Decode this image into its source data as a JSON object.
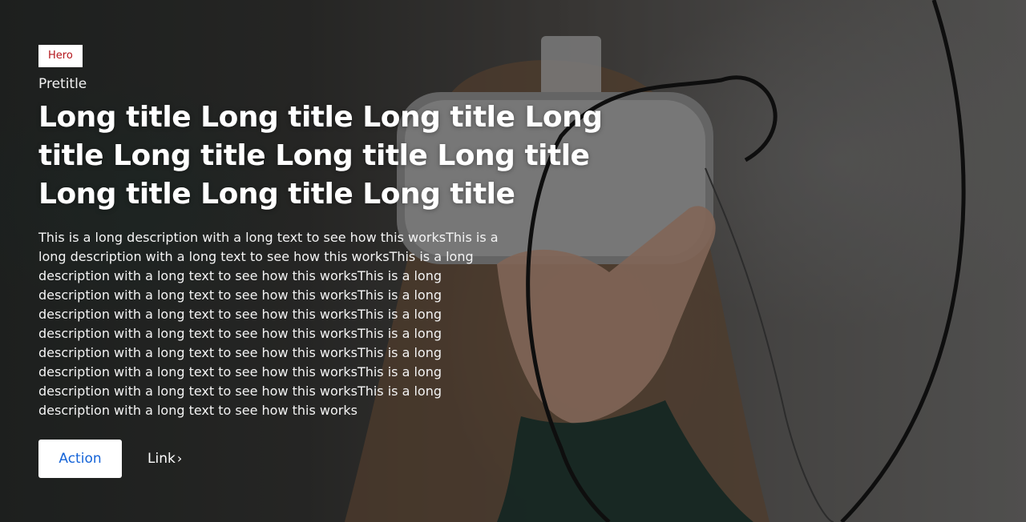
{
  "hero": {
    "badge": "Hero",
    "pretitle": "Pretitle",
    "title": "Long title Long title Long title Long title Long title Long title Long title Long title Long title Long title",
    "description": "This is a long description with a long text to see how this worksThis is a long description with a long text to see how this worksThis is a long description with a long text to see how this worksThis is a long description with a long text to see how this worksThis is a long description with a long text to see how this worksThis is a long description with a long text to see how this worksThis is a long description with a long text to see how this worksThis is a long description with a long text to see how this worksThis is a long description with a long text to see how this worksThis is a long description with a long text to see how this works",
    "action_label": "Action",
    "link_label": "Link",
    "link_icon": "chevron-right-icon"
  },
  "colors": {
    "badge_text": "#b3151b",
    "action_text": "#1564d8",
    "text": "#ffffff"
  }
}
